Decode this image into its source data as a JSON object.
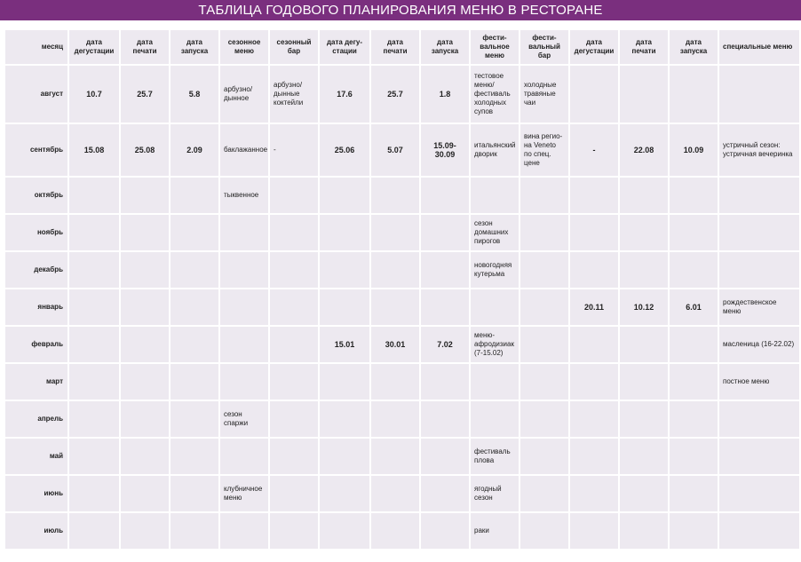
{
  "title": "ТАБЛИЦА ГОДОВОГО ПЛАНИРОВАНИЯ МЕНЮ В РЕСТОРАНЕ",
  "headers": [
    "месяц",
    "дата дегустации",
    "дата печати",
    "дата запуска",
    "сезонное меню",
    "сезонный бар",
    "дата дегу-стации",
    "дата печати",
    "дата запуска",
    "фести-вальное меню",
    "фести-вальный бар",
    "дата дегустации",
    "дата печати",
    "дата запуска",
    "специальные меню"
  ],
  "rows": [
    [
      "август",
      "10.7",
      "25.7",
      "5.8",
      "арбузно/ дынное",
      "арбузно/ дынные коктейли",
      "17.6",
      "25.7",
      "1.8",
      "тестовое меню/ фестиваль холодных супов",
      "холодные травяные чаи",
      "",
      "",
      "",
      ""
    ],
    [
      "сентябрь",
      "15.08",
      "25.08",
      "2.09",
      "баклажанное",
      "-",
      "25.06",
      "5.07",
      "15.09-30.09",
      "итальянский дворик",
      "вина регио-на Veneto по спец. цене",
      "-",
      "22.08",
      "10.09",
      "устричный сезон: устричная вечеринка"
    ],
    [
      "октябрь",
      "",
      "",
      "",
      "тыквенное",
      "",
      "",
      "",
      "",
      "",
      "",
      "",
      "",
      "",
      ""
    ],
    [
      "ноябрь",
      "",
      "",
      "",
      "",
      "",
      "",
      "",
      "",
      "сезон домашних пирогов",
      "",
      "",
      "",
      "",
      ""
    ],
    [
      "декабрь",
      "",
      "",
      "",
      "",
      "",
      "",
      "",
      "",
      "новогодняя кутерьма",
      "",
      "",
      "",
      "",
      ""
    ],
    [
      "январь",
      "",
      "",
      "",
      "",
      "",
      "",
      "",
      "",
      "",
      "",
      "20.11",
      "10.12",
      "6.01",
      "рождественское меню"
    ],
    [
      "февраль",
      "",
      "",
      "",
      "",
      "",
      "15.01",
      "30.01",
      "7.02",
      "меню-афродизиак (7-15.02)",
      "",
      "",
      "",
      "",
      "масленица (16-22.02)"
    ],
    [
      "март",
      "",
      "",
      "",
      "",
      "",
      "",
      "",
      "",
      "",
      "",
      "",
      "",
      "",
      "постное меню"
    ],
    [
      "апрель",
      "",
      "",
      "",
      "сезон спаржи",
      "",
      "",
      "",
      "",
      "",
      "",
      "",
      "",
      "",
      ""
    ],
    [
      "май",
      "",
      "",
      "",
      "",
      "",
      "",
      "",
      "",
      "фестиваль плова",
      "",
      "",
      "",
      "",
      ""
    ],
    [
      "июнь",
      "",
      "",
      "",
      "клубничное меню",
      "",
      "",
      "",
      "",
      "ягодный сезон",
      "",
      "",
      "",
      "",
      ""
    ],
    [
      "июль",
      "",
      "",
      "",
      "",
      "",
      "",
      "",
      "",
      "раки",
      "",
      "",
      "",
      "",
      ""
    ]
  ]
}
